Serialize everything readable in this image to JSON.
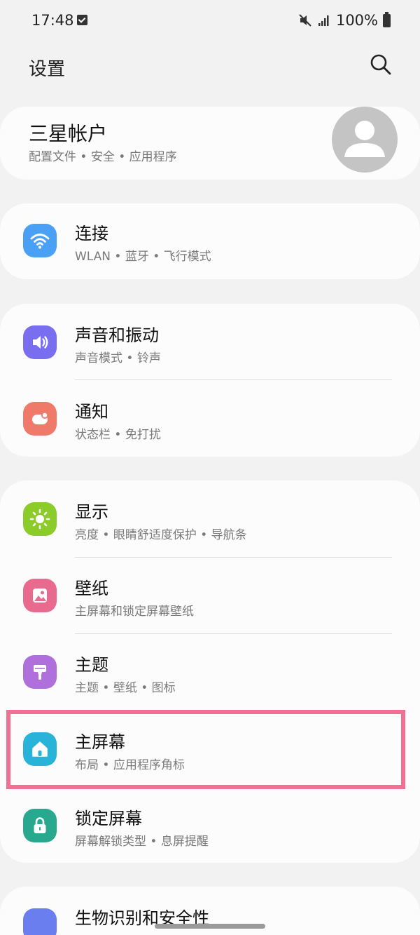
{
  "status": {
    "time": "17:48",
    "battery": "100%"
  },
  "header": {
    "title": "设置"
  },
  "account": {
    "title": "三星帐户",
    "subtitle": "配置文件 • 安全 • 应用程序"
  },
  "settings": [
    {
      "title": "连接",
      "subtitle": "WLAN • 蓝牙 • 飞行模式",
      "icon": "wifi-icon",
      "color": "#4aa0f5"
    },
    {
      "title": "声音和振动",
      "subtitle": "声音模式 • 铃声",
      "icon": "volume-icon",
      "color": "#7a6ef0"
    },
    {
      "title": "通知",
      "subtitle": "状态栏 • 免打扰",
      "icon": "notification-icon",
      "color": "#f07a6a"
    },
    {
      "title": "显示",
      "subtitle": "亮度 • 眼睛舒适度保护 • 导航条",
      "icon": "brightness-icon",
      "color": "#8ccc2a"
    },
    {
      "title": "壁纸",
      "subtitle": "主屏幕和锁定屏幕壁纸",
      "icon": "wallpaper-icon",
      "color": "#e86a8e"
    },
    {
      "title": "主题",
      "subtitle": "主题 • 壁纸 • 图标",
      "icon": "theme-icon",
      "color": "#b070dc"
    },
    {
      "title": "主屏幕",
      "subtitle": "布局 • 应用程序角标",
      "icon": "home-icon",
      "color": "#2ab3d8"
    },
    {
      "title": "锁定屏幕",
      "subtitle": "屏幕解锁类型 • 息屏提醒",
      "icon": "lock-icon",
      "color": "#28a88e"
    },
    {
      "title": "生物识别和安全性",
      "subtitle": "",
      "icon": "shield-icon",
      "color": "#6a7ef0"
    }
  ],
  "highlight_color": "#f07094"
}
